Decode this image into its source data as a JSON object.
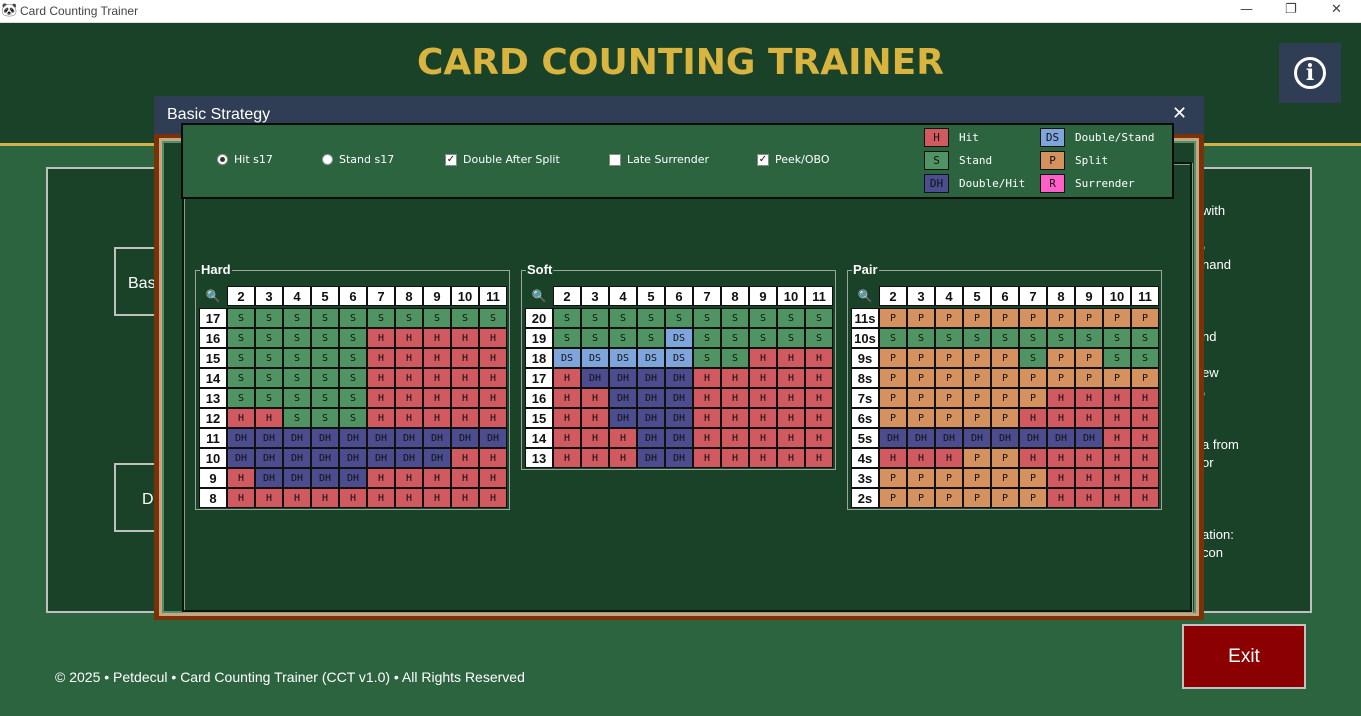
{
  "window": {
    "title": "Card Counting Trainer",
    "icon": "🐼",
    "min": "—",
    "max": "❐",
    "close": "✕"
  },
  "header": {
    "title": "CARD COUNTING TRAINER",
    "info_glyph": "i"
  },
  "background": {
    "buttons": [
      "Bas",
      "D"
    ],
    "text_fragments": [
      "with",
      ",",
      "hand",
      "nd",
      "ew",
      ",",
      "a from",
      "or",
      "ation:",
      "con"
    ]
  },
  "footer": {
    "text": "© 2025 • Petdecul • Card Counting Trainer (CCT v1.0) • All Rights Reserved"
  },
  "exit_label": "Exit",
  "dialog": {
    "title": "Basic Strategy",
    "close": "✕",
    "options": [
      {
        "label": "Hit s17",
        "kind": "radio",
        "checked": true
      },
      {
        "label": "Stand s17",
        "kind": "radio",
        "checked": false
      },
      {
        "label": "Double After Split",
        "kind": "check",
        "checked": true
      },
      {
        "label": "Late Surrender",
        "kind": "check",
        "checked": false
      },
      {
        "label": "Peek/OBO",
        "kind": "check",
        "checked": true
      }
    ],
    "legend": [
      {
        "code": "H",
        "label": "Hit"
      },
      {
        "code": "S",
        "label": "Stand"
      },
      {
        "code": "DH",
        "label": "Double/Hit"
      },
      {
        "code": "DS",
        "label": "Double/Stand"
      },
      {
        "code": "P",
        "label": "Split"
      },
      {
        "code": "R",
        "label": "Surrender"
      }
    ],
    "colors": {
      "H": "#d05a60",
      "S": "#4f9462",
      "DH": "#4b4d8e",
      "DS": "#7fa6dc",
      "P": "#d5915e",
      "R": "#ff5fc6"
    },
    "zoom_glyph": "🔍",
    "dealer": [
      "2",
      "3",
      "4",
      "5",
      "6",
      "7",
      "8",
      "9",
      "10",
      "11"
    ],
    "tables": [
      {
        "name": "Hard",
        "rows": [
          {
            "label": "17",
            "cells": [
              "S",
              "S",
              "S",
              "S",
              "S",
              "S",
              "S",
              "S",
              "S",
              "S"
            ]
          },
          {
            "label": "16",
            "cells": [
              "S",
              "S",
              "S",
              "S",
              "S",
              "H",
              "H",
              "H",
              "H",
              "H"
            ]
          },
          {
            "label": "15",
            "cells": [
              "S",
              "S",
              "S",
              "S",
              "S",
              "H",
              "H",
              "H",
              "H",
              "H"
            ]
          },
          {
            "label": "14",
            "cells": [
              "S",
              "S",
              "S",
              "S",
              "S",
              "H",
              "H",
              "H",
              "H",
              "H"
            ]
          },
          {
            "label": "13",
            "cells": [
              "S",
              "S",
              "S",
              "S",
              "S",
              "H",
              "H",
              "H",
              "H",
              "H"
            ]
          },
          {
            "label": "12",
            "cells": [
              "H",
              "H",
              "S",
              "S",
              "S",
              "H",
              "H",
              "H",
              "H",
              "H"
            ]
          },
          {
            "label": "11",
            "cells": [
              "DH",
              "DH",
              "DH",
              "DH",
              "DH",
              "DH",
              "DH",
              "DH",
              "DH",
              "DH"
            ]
          },
          {
            "label": "10",
            "cells": [
              "DH",
              "DH",
              "DH",
              "DH",
              "DH",
              "DH",
              "DH",
              "DH",
              "H",
              "H"
            ]
          },
          {
            "label": "9",
            "cells": [
              "H",
              "DH",
              "DH",
              "DH",
              "DH",
              "H",
              "H",
              "H",
              "H",
              "H"
            ]
          },
          {
            "label": "8",
            "cells": [
              "H",
              "H",
              "H",
              "H",
              "H",
              "H",
              "H",
              "H",
              "H",
              "H"
            ]
          }
        ]
      },
      {
        "name": "Soft",
        "rows": [
          {
            "label": "20",
            "cells": [
              "S",
              "S",
              "S",
              "S",
              "S",
              "S",
              "S",
              "S",
              "S",
              "S"
            ]
          },
          {
            "label": "19",
            "cells": [
              "S",
              "S",
              "S",
              "S",
              "DS",
              "S",
              "S",
              "S",
              "S",
              "S"
            ]
          },
          {
            "label": "18",
            "cells": [
              "DS",
              "DS",
              "DS",
              "DS",
              "DS",
              "S",
              "S",
              "H",
              "H",
              "H"
            ]
          },
          {
            "label": "17",
            "cells": [
              "H",
              "DH",
              "DH",
              "DH",
              "DH",
              "H",
              "H",
              "H",
              "H",
              "H"
            ]
          },
          {
            "label": "16",
            "cells": [
              "H",
              "H",
              "DH",
              "DH",
              "DH",
              "H",
              "H",
              "H",
              "H",
              "H"
            ]
          },
          {
            "label": "15",
            "cells": [
              "H",
              "H",
              "DH",
              "DH",
              "DH",
              "H",
              "H",
              "H",
              "H",
              "H"
            ]
          },
          {
            "label": "14",
            "cells": [
              "H",
              "H",
              "H",
              "DH",
              "DH",
              "H",
              "H",
              "H",
              "H",
              "H"
            ]
          },
          {
            "label": "13",
            "cells": [
              "H",
              "H",
              "H",
              "DH",
              "DH",
              "H",
              "H",
              "H",
              "H",
              "H"
            ]
          }
        ]
      },
      {
        "name": "Pair",
        "rows": [
          {
            "label": "11s",
            "cells": [
              "P",
              "P",
              "P",
              "P",
              "P",
              "P",
              "P",
              "P",
              "P",
              "P"
            ]
          },
          {
            "label": "10s",
            "cells": [
              "S",
              "S",
              "S",
              "S",
              "S",
              "S",
              "S",
              "S",
              "S",
              "S"
            ]
          },
          {
            "label": "9s",
            "cells": [
              "P",
              "P",
              "P",
              "P",
              "P",
              "S",
              "P",
              "P",
              "S",
              "S"
            ]
          },
          {
            "label": "8s",
            "cells": [
              "P",
              "P",
              "P",
              "P",
              "P",
              "P",
              "P",
              "P",
              "P",
              "P"
            ]
          },
          {
            "label": "7s",
            "cells": [
              "P",
              "P",
              "P",
              "P",
              "P",
              "P",
              "H",
              "H",
              "H",
              "H"
            ]
          },
          {
            "label": "6s",
            "cells": [
              "P",
              "P",
              "P",
              "P",
              "P",
              "H",
              "H",
              "H",
              "H",
              "H"
            ]
          },
          {
            "label": "5s",
            "cells": [
              "DH",
              "DH",
              "DH",
              "DH",
              "DH",
              "DH",
              "DH",
              "DH",
              "H",
              "H"
            ]
          },
          {
            "label": "4s",
            "cells": [
              "H",
              "H",
              "H",
              "P",
              "P",
              "H",
              "H",
              "H",
              "H",
              "H"
            ]
          },
          {
            "label": "3s",
            "cells": [
              "P",
              "P",
              "P",
              "P",
              "P",
              "P",
              "H",
              "H",
              "H",
              "H"
            ]
          },
          {
            "label": "2s",
            "cells": [
              "P",
              "P",
              "P",
              "P",
              "P",
              "P",
              "H",
              "H",
              "H",
              "H"
            ]
          }
        ]
      }
    ]
  }
}
